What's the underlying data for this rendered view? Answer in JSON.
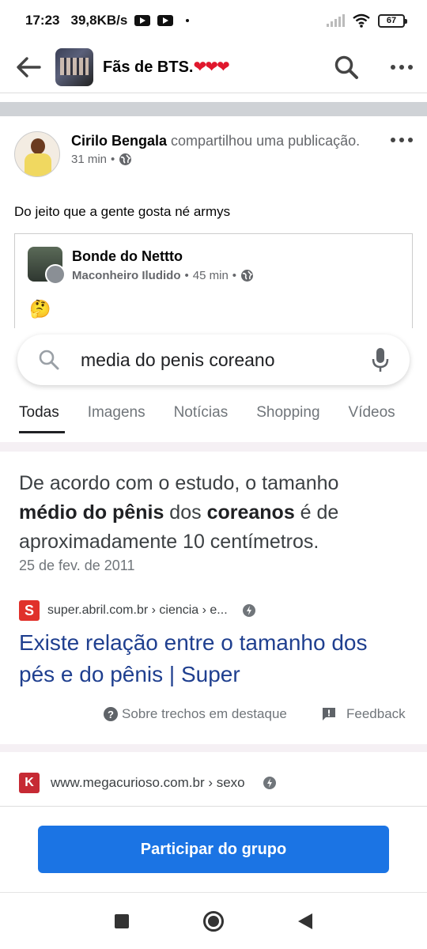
{
  "status_bar": {
    "time": "17:23",
    "speed": "39,8KB/s",
    "battery": "67"
  },
  "header": {
    "group_name": "Fãs de BTS.",
    "group_hearts": "❤❤❤"
  },
  "post": {
    "author": "Cirilo Bengala",
    "action": " compartilhou uma publicação.",
    "time": "31 min",
    "separator": "•",
    "text": "Do jeito que a gente gosta né armys"
  },
  "shared_post": {
    "page_name": "Bonde do Nettto",
    "author": "Maconheiro Iludido",
    "time": "45 min",
    "separator": "•",
    "emoji": "🤔"
  },
  "google_screenshot": {
    "query": "media do penis coreano",
    "tabs": [
      "Todas",
      "Imagens",
      "Notícias",
      "Shopping",
      "Vídeos"
    ],
    "snippet_parts": {
      "p1": "De acordo com o estudo, o tamanho ",
      "b1": "médio do pênis",
      "p2": " dos ",
      "b2": "coreanos",
      "p3": " é de aproximadamente 10 centímetros."
    },
    "date": "25 de fev. de 2011",
    "result1_site": "super.abril.com.br › ciencia › e...",
    "result1_title": "Existe relação entre o tamanho dos pés e do pênis | Super",
    "about_snippets": "Sobre trechos em destaque",
    "feedback": "Feedback",
    "result2_site": "www.megacurioso.com.br › sexo"
  },
  "join_button": "Participar do grupo",
  "colors": {
    "primary_button": "#1b74e4",
    "hearts": "#e0182d",
    "link": "#1f3f8f"
  }
}
